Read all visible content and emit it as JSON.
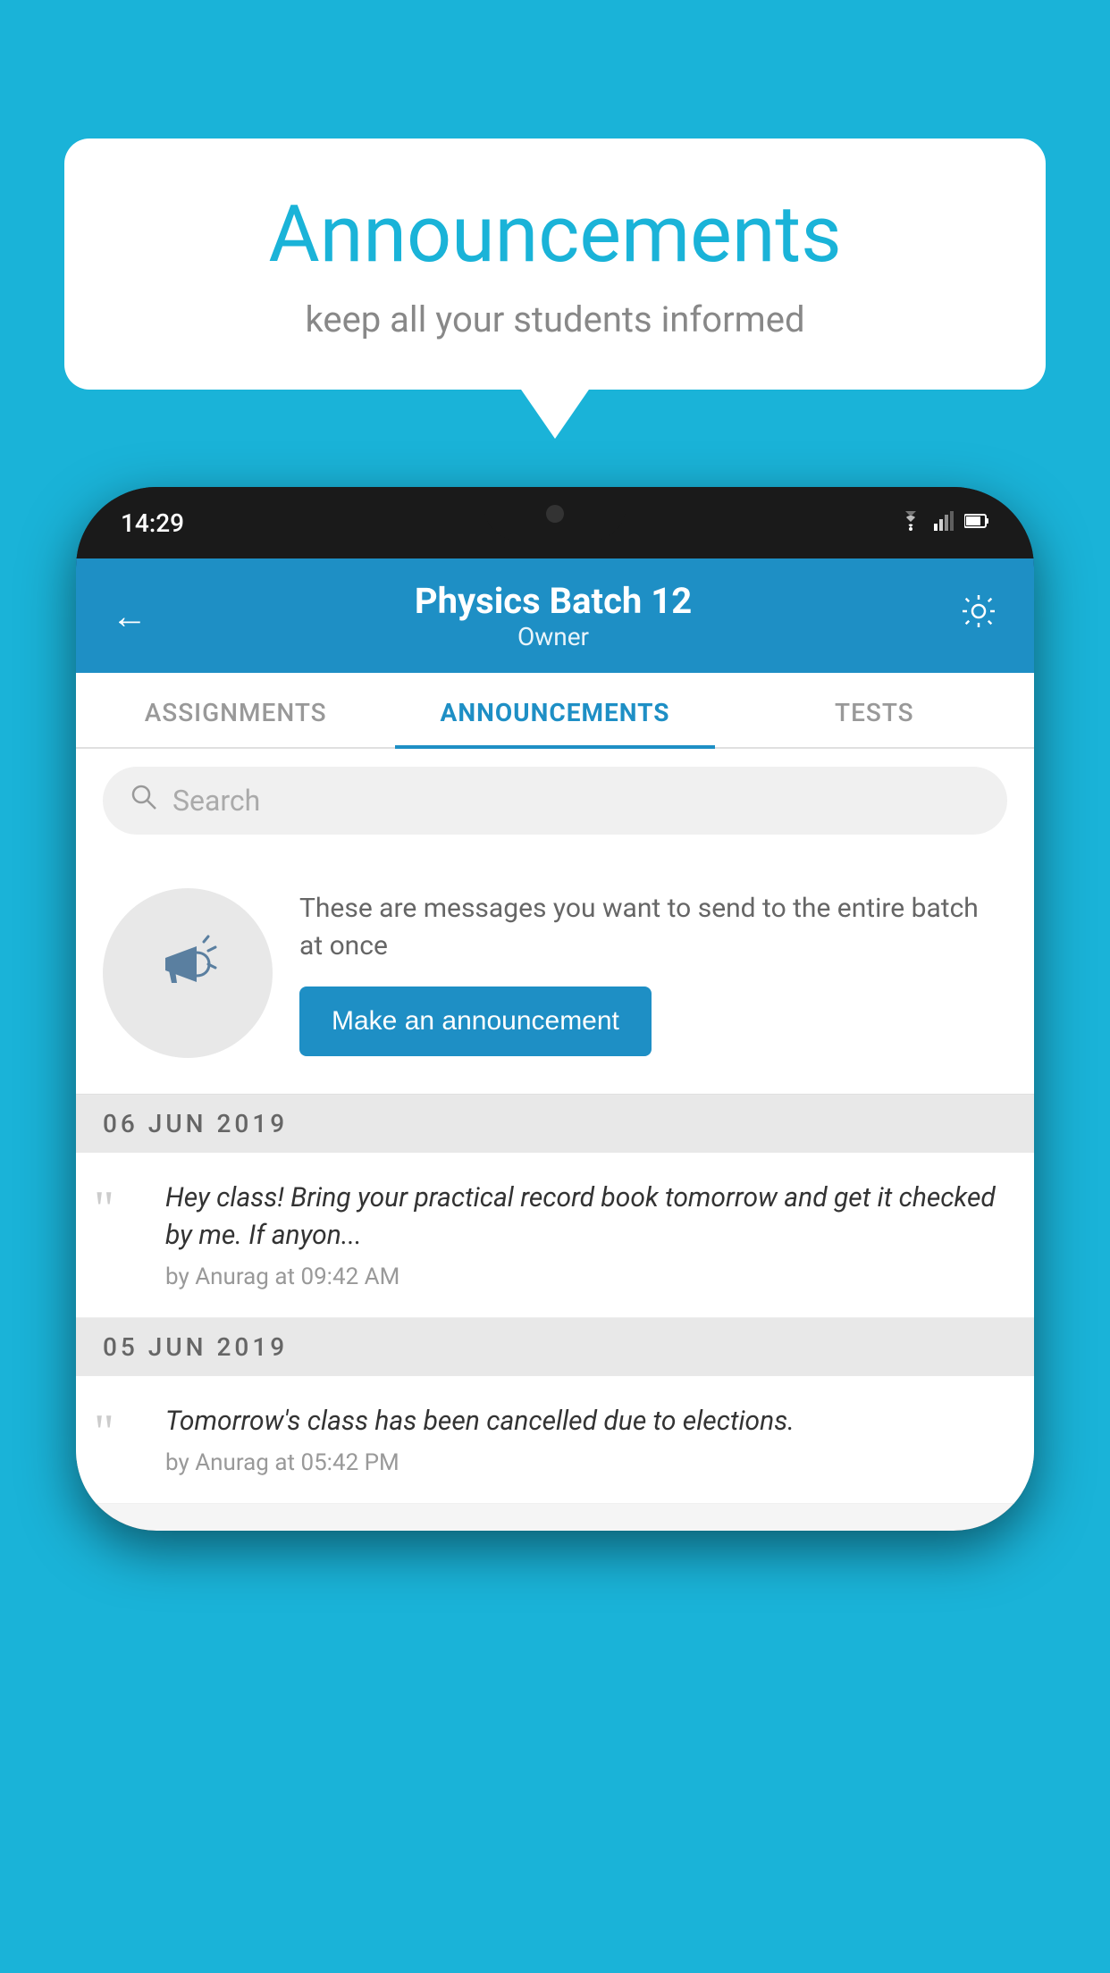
{
  "background_color": "#1ab3d8",
  "speech_bubble": {
    "title": "Announcements",
    "subtitle": "keep all your students informed"
  },
  "phone": {
    "status_bar": {
      "time": "14:29"
    },
    "header": {
      "back_label": "←",
      "title": "Physics Batch 12",
      "subtitle": "Owner",
      "settings_icon": "⚙"
    },
    "tabs": [
      {
        "label": "ASSIGNMENTS",
        "active": false
      },
      {
        "label": "ANNOUNCEMENTS",
        "active": true
      },
      {
        "label": "TESTS",
        "active": false
      }
    ],
    "search": {
      "placeholder": "Search"
    },
    "promo": {
      "description": "These are messages you want to send to the entire batch at once",
      "button_label": "Make an announcement"
    },
    "announcements": [
      {
        "date": "06  JUN  2019",
        "text": "Hey class! Bring your practical record book tomorrow and get it checked by me. If anyon...",
        "meta": "by Anurag at 09:42 AM"
      },
      {
        "date": "05  JUN  2019",
        "text": "Tomorrow's class has been cancelled due to elections.",
        "meta": "by Anurag at 05:42 PM"
      }
    ]
  }
}
